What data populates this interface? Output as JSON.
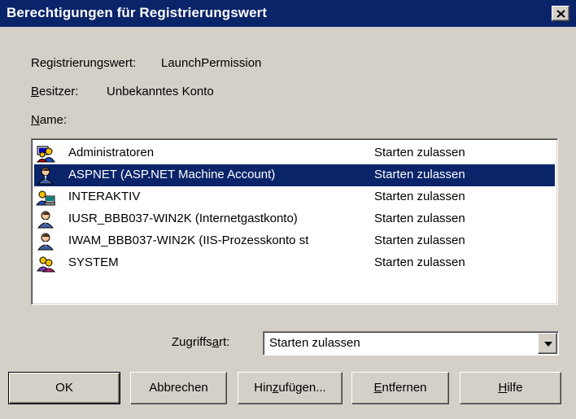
{
  "dialog": {
    "title": "Berechtigungen für Registrierungswert"
  },
  "info": {
    "value_label": "Registrierungswert:",
    "value_text": "LaunchPermission",
    "owner_label_accel": "B",
    "owner_label_rest": "esitzer:",
    "owner_text": "Unbekanntes Konto",
    "name_label_accel": "N",
    "name_label_rest": "ame:"
  },
  "list": {
    "rows": [
      {
        "icon": "group-icon",
        "name": "Administratoren",
        "permission": "Starten zulassen",
        "selected": false
      },
      {
        "icon": "user-icon",
        "name": "ASPNET (ASP.NET Machine Account)",
        "permission": "Starten zulassen",
        "selected": true
      },
      {
        "icon": "interactive-group-icon",
        "name": "INTERAKTIV",
        "permission": "Starten zulassen",
        "selected": false
      },
      {
        "icon": "user-icon",
        "name": "IUSR_BBB037-WIN2K (Internetgastkonto)",
        "permission": "Starten zulassen",
        "selected": false
      },
      {
        "icon": "user-icon",
        "name": "IWAM_BBB037-WIN2K (IIS-Prozesskonto st",
        "permission": "Starten zulassen",
        "selected": false
      },
      {
        "icon": "system-group-icon",
        "name": "SYSTEM",
        "permission": "Starten zulassen",
        "selected": false
      }
    ]
  },
  "access": {
    "label_pre": "Zugriffs",
    "label_accel": "a",
    "label_post": "rt:",
    "selected_value": "Starten zulassen"
  },
  "buttons": {
    "ok": "OK",
    "cancel": "Abbrechen",
    "add_pre": "Hin",
    "add_accel": "z",
    "add_post": "ufügen...",
    "remove_accel": "E",
    "remove_post": "ntfernen",
    "help_accel": "H",
    "help_post": "ilfe"
  },
  "colors": {
    "titlebar": "#0a246a",
    "face": "#d4d0c8",
    "selection": "#0a246a"
  }
}
